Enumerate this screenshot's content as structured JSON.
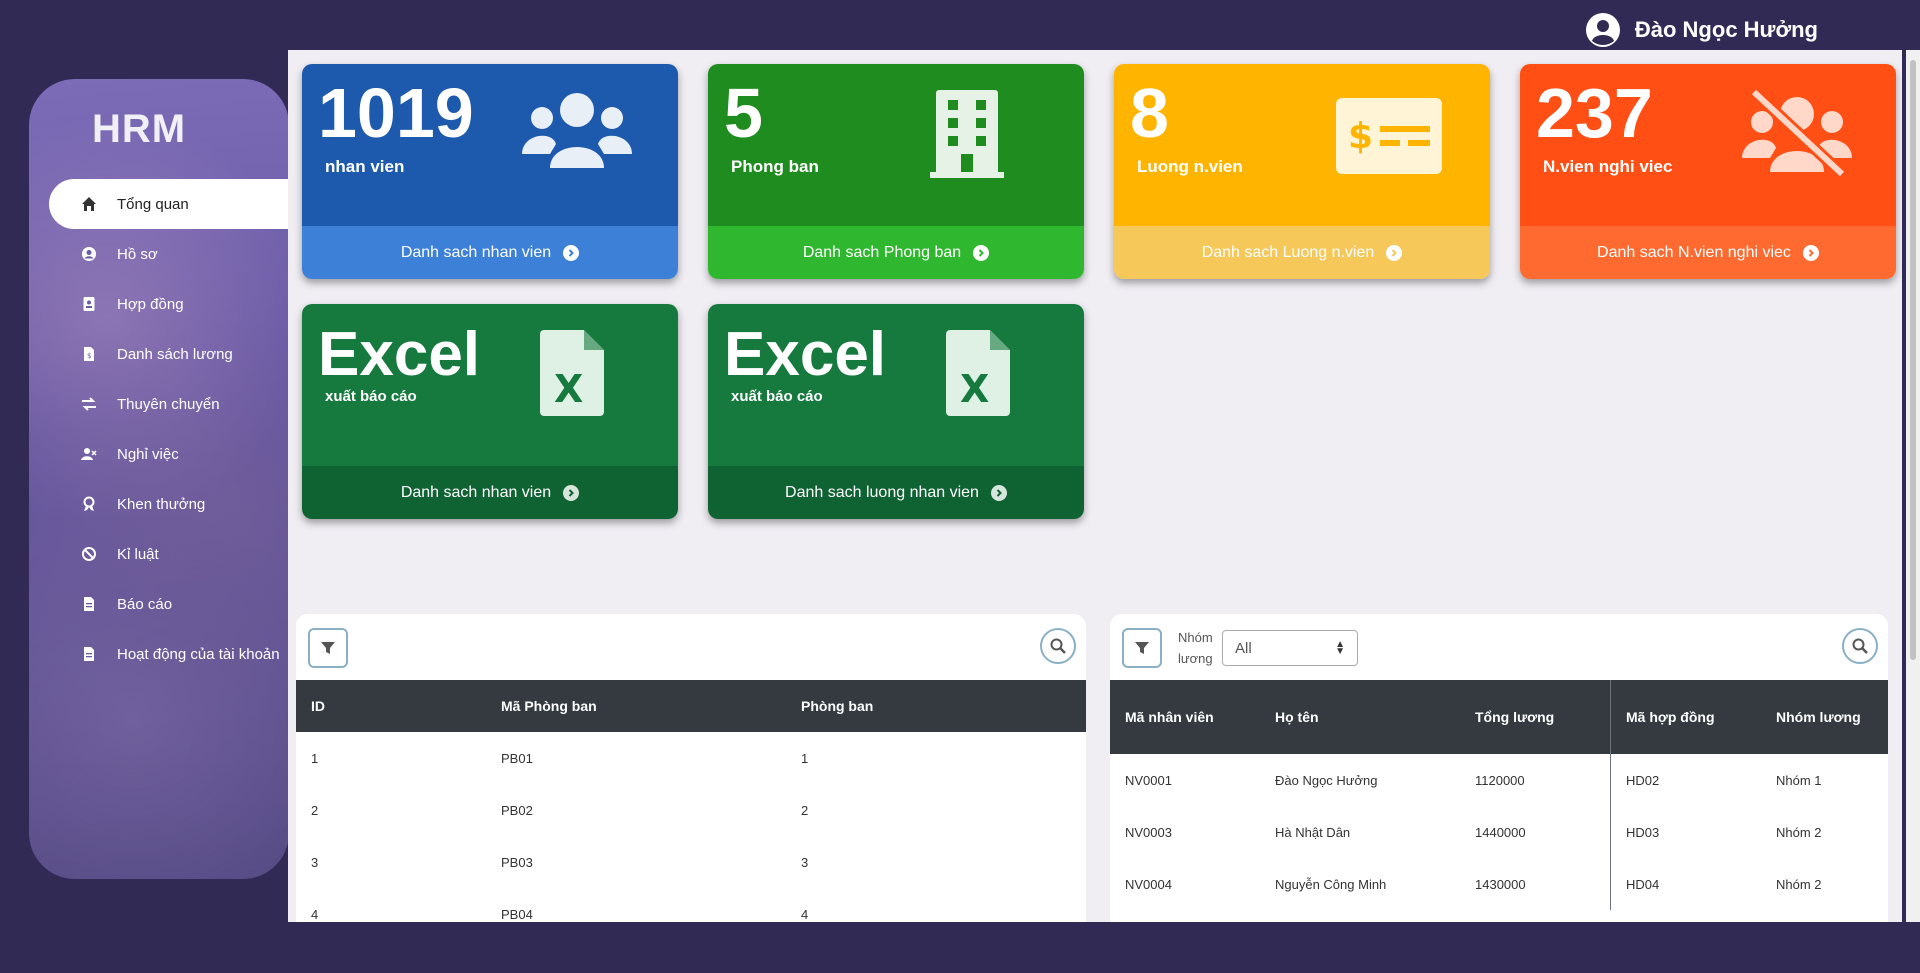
{
  "user": {
    "name": "Đào Ngọc Hưởng"
  },
  "sidebar": {
    "brand": "HRM",
    "items": [
      {
        "label": "Tổng quan",
        "icon": "home-icon"
      },
      {
        "label": "Hồ sơ",
        "icon": "user-circle-icon"
      },
      {
        "label": "Hợp đồng",
        "icon": "contract-icon"
      },
      {
        "label": "Danh sách lương",
        "icon": "salary-file-icon"
      },
      {
        "label": "Thuyên chuyển",
        "icon": "transfer-icon"
      },
      {
        "label": "Nghỉ việc",
        "icon": "user-x-icon"
      },
      {
        "label": "Khen thưởng",
        "icon": "award-icon"
      },
      {
        "label": "Kỉ luật",
        "icon": "ban-icon"
      },
      {
        "label": "Báo cáo",
        "icon": "report-icon"
      },
      {
        "label": "Hoạt động của tài khoản",
        "icon": "activity-file-icon"
      }
    ]
  },
  "cards": [
    {
      "value": "1019",
      "label": "nhan vien",
      "link": "Danh sach nhan vien",
      "icon": "users-icon",
      "color_top": "#1d5aae",
      "color_bottom": "#3c80d8"
    },
    {
      "value": "5",
      "label": "Phong ban",
      "link": "Danh sach Phong ban",
      "icon": "building-icon",
      "color_top": "#1e8c1e",
      "color_bottom": "#2fb82f"
    },
    {
      "value": "8",
      "label": "Luong n.vien",
      "link": "Danh sach Luong n.vien",
      "icon": "money-check-icon",
      "color_top": "#ffb400",
      "color_bottom": "#f6c85a"
    },
    {
      "value": "237",
      "label": "N.vien nghi viec",
      "link": "Danh sach N.vien nghi viec",
      "icon": "users-slash-icon",
      "color_top": "#ff4f14",
      "color_bottom": "#ff6a30"
    },
    {
      "value": "Excel",
      "label": "xuất báo cáo",
      "link": "Danh sach nhan vien",
      "icon": "excel-file-icon",
      "color_top": "#167a3e",
      "color_bottom": "#0f6232"
    },
    {
      "value": "Excel",
      "label": "xuất báo cáo",
      "link": "Danh sach luong nhan vien",
      "icon": "excel-file-icon",
      "color_top": "#167a3e",
      "color_bottom": "#0f6232"
    }
  ],
  "dept_table": {
    "columns": [
      "ID",
      "Mã Phòng ban",
      "Phòng ban"
    ],
    "rows": [
      [
        "1",
        "PB01",
        "1"
      ],
      [
        "2",
        "PB02",
        "2"
      ],
      [
        "3",
        "PB03",
        "3"
      ],
      [
        "4",
        "PB04",
        "4"
      ]
    ]
  },
  "salary_table": {
    "group_label_1": "Nhóm",
    "group_label_2": "lương",
    "select_value": "All",
    "columns": [
      "Mã nhân viên",
      "Họ tên",
      "Tổng lương",
      "Mã hợp đồng",
      "Nhóm lương"
    ],
    "rows": [
      [
        "NV0001",
        "Đào Ngọc Hưởng",
        "1120000",
        "HD02",
        "Nhóm 1"
      ],
      [
        "NV0003",
        "Hà Nhật Dân",
        "1440000",
        "HD03",
        "Nhóm 2"
      ],
      [
        "NV0004",
        "Nguyễn Công Minh",
        "1430000",
        "HD04",
        "Nhóm 2"
      ]
    ]
  }
}
